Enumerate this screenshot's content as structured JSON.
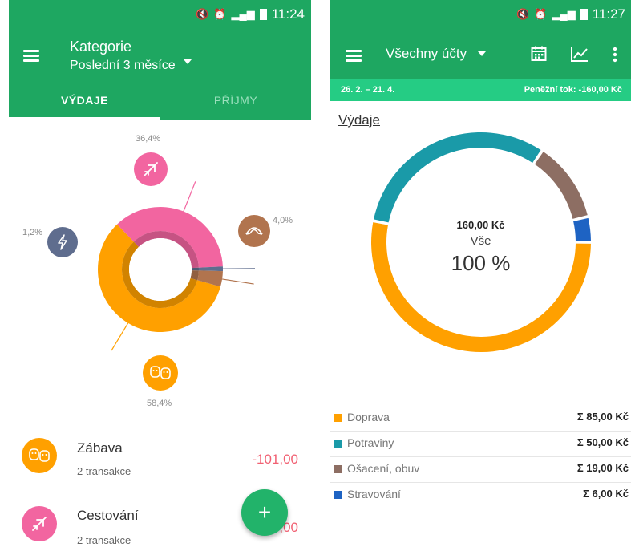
{
  "left": {
    "status": {
      "time": "11:24"
    },
    "header": {
      "title": "Kategorie",
      "subtitle": "Poslední 3 měsíce"
    },
    "tabs": [
      {
        "label": "VÝDAJE",
        "active": true
      },
      {
        "label": "PŘÍJMY",
        "active": false
      }
    ],
    "chart_data": {
      "type": "pie",
      "categories": [
        "Zábava",
        "Cestování",
        "Energie",
        "Jídlo"
      ],
      "values": [
        58.4,
        36.4,
        1.2,
        4.0
      ],
      "labels": [
        "58,4%",
        "36,4%",
        "1,2%",
        "4,0%"
      ],
      "colors": [
        "#ffa000",
        "#f265a0",
        "#5f6d8e",
        "#b1744e"
      ],
      "icons": [
        "theater-masks-icon",
        "airplane-icon",
        "lightning-icon",
        "croissant-icon"
      ]
    },
    "list": [
      {
        "name": "Zábava",
        "sub": "2 transakce",
        "amount": "-101,00",
        "color": "#ffa000",
        "icon": "theater-masks-icon"
      },
      {
        "name": "Cestování",
        "sub": "2 transakce",
        "amount": "-63,00",
        "color": "#f265a0",
        "icon": "airplane-icon"
      }
    ],
    "fab": {
      "label": "+",
      "color": "#22b36a"
    },
    "accent": "#1ea761"
  },
  "right": {
    "status": {
      "time": "11:27"
    },
    "header": {
      "title": "Všechny účty"
    },
    "period": {
      "range": "26. 2. – 21. 4.",
      "cashflow": "Peněžní tok: -160,00 Kč"
    },
    "section_title": "Výdaje",
    "center": {
      "amount": "160,00 Kč",
      "label": "Vše",
      "percent": "100 %"
    },
    "chart_data": {
      "type": "pie",
      "categories": [
        "Doprava",
        "Potraviny",
        "Ošacení, obuv",
        "Stravování"
      ],
      "values": [
        85,
        50,
        19,
        6
      ],
      "colors": [
        "#ffa000",
        "#1a9aa8",
        "#8d6e63",
        "#1e63c3"
      ]
    },
    "legend": [
      {
        "name": "Doprava",
        "value": "Σ 85,00 Kč",
        "color": "#ffa000"
      },
      {
        "name": "Potraviny",
        "value": "Σ 50,00 Kč",
        "color": "#1a9aa8"
      },
      {
        "name": "Ošacení, obuv",
        "value": "Σ 19,00 Kč",
        "color": "#8d6e63"
      },
      {
        "name": "Stravování",
        "value": "Σ 6,00 Kč",
        "color": "#1e63c3"
      }
    ],
    "accent": "#1ea761",
    "accent_light": "#25cc84"
  }
}
